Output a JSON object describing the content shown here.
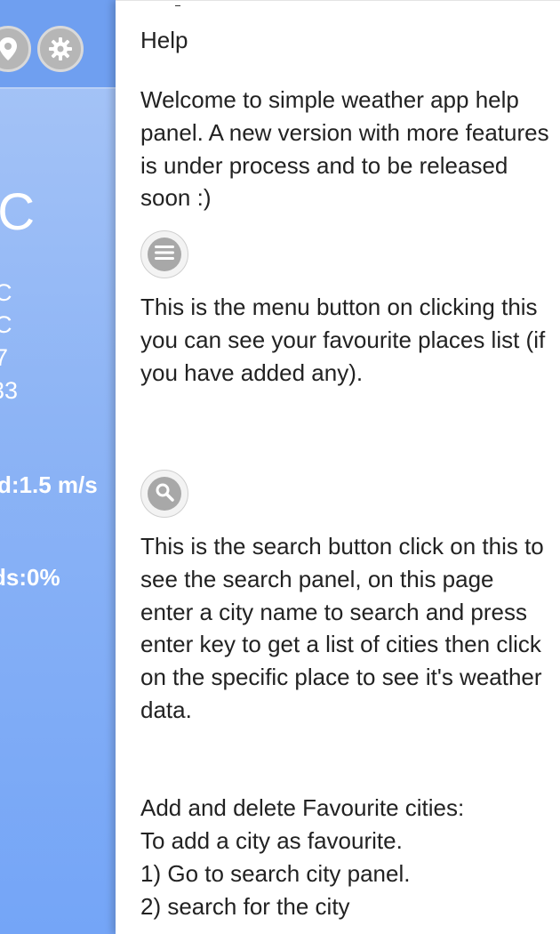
{
  "weather": {
    "temp_main": "°C",
    "stats": [
      "C",
      "C",
      "7",
      "33"
    ],
    "wind": "d:1.5 m/s",
    "clouds": "ds:0%"
  },
  "help": {
    "title": "Help",
    "intro": "Welcome to simple weather app help panel. A new version with more features is under process and to be released soon :)",
    "menu_desc": "This is the menu button on clicking this you can see your favourite places list (if you have added any).",
    "search_desc": "This is the search button click on this to see the search panel, on this page enter a city name to search and press enter key to get a list of cities then click on the specific place to see it's weather data.",
    "fav_lines": [
      "Add and delete Favourite cities:",
      "To add a city as favourite.",
      "1) Go to search city panel.",
      "2) search for the city"
    ]
  }
}
